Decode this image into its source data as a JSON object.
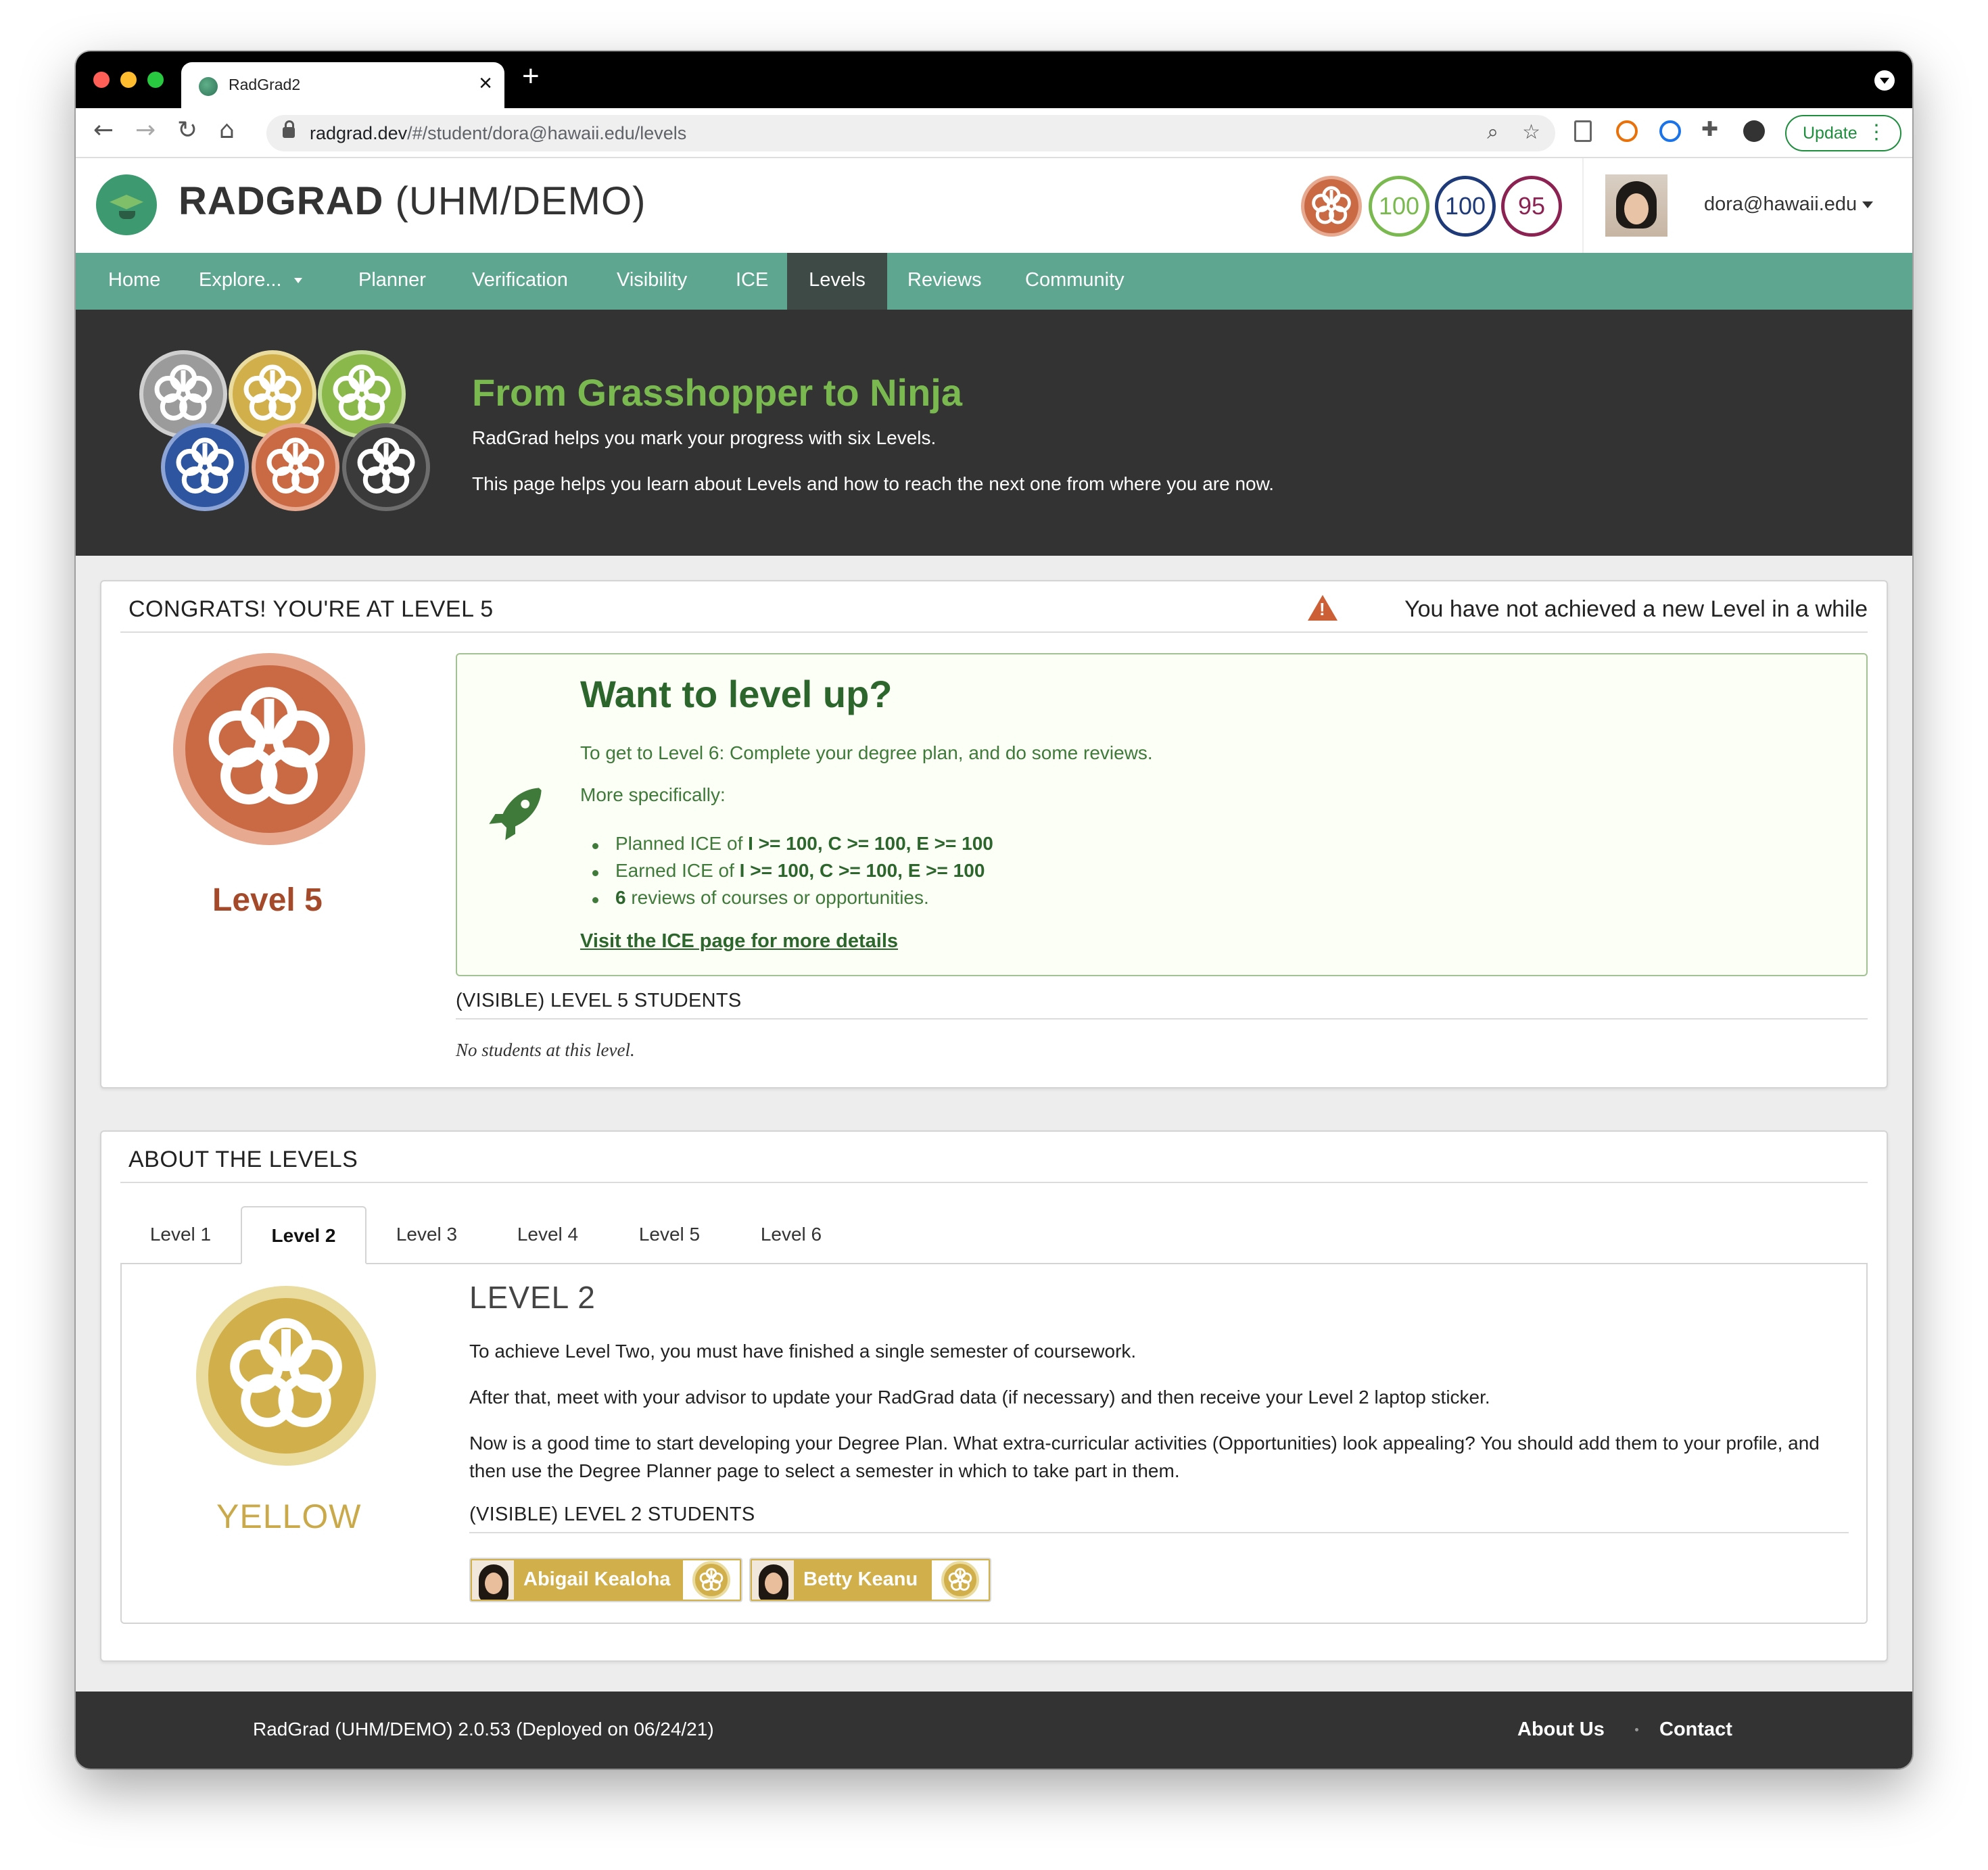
{
  "browser": {
    "tab_title": "RadGrad2",
    "url_host": "radgrad.dev",
    "url_path": "/#/student/dora@hawaii.edu/levels",
    "update_label": "Update"
  },
  "header": {
    "title_bold": "RADGRAD",
    "title_rest": " (UHM/DEMO)",
    "scores": [
      {
        "value": "100",
        "color": "#79b94f"
      },
      {
        "value": "100",
        "color": "#1e3a78"
      },
      {
        "value": "95",
        "color": "#8b2252"
      }
    ],
    "user_email": "dora@hawaii.edu"
  },
  "menu": {
    "items": [
      "Home",
      "Explore...",
      "Planner",
      "Verification",
      "Visibility",
      "ICE",
      "Levels",
      "Reviews",
      "Community"
    ],
    "active": "Levels"
  },
  "hero": {
    "title": "From Grasshopper to Ninja",
    "line1": "RadGrad helps you mark your progress with six Levels.",
    "line2": "This page helps you learn about Levels and how to reach the next one from where you are now."
  },
  "current_level": {
    "header": "CONGRATS! YOU'RE AT LEVEL 5",
    "warning": "You have not achieved a new Level in a while",
    "label": "Level 5",
    "levelup": {
      "title": "Want to level up?",
      "line1": "To get to Level 6: Complete your degree plan, and do some reviews.",
      "line2": "More specifically:",
      "items": [
        {
          "prefix": "Planned ICE of ",
          "bold": "I >= 100, C >= 100, E >= 100",
          "suffix": ""
        },
        {
          "prefix": "Earned ICE of ",
          "bold": "I >= 100, C >= 100, E >= 100",
          "suffix": ""
        },
        {
          "prefix": "",
          "bold": "6",
          "suffix": " reviews of courses or opportunities."
        }
      ],
      "link": "Visit the ICE page for more details"
    },
    "students_header": "(VISIBLE) LEVEL 5 STUDENTS",
    "no_students": "No students at this level."
  },
  "about": {
    "header": "ABOUT THE LEVELS",
    "tabs": [
      "Level 1",
      "Level 2",
      "Level 3",
      "Level 4",
      "Level 5",
      "Level 6"
    ],
    "active_tab": "Level 2",
    "panel": {
      "title": "LEVEL 2",
      "color_name": "YELLOW",
      "p1": "To achieve Level Two, you must have finished a single semester of coursework.",
      "p2": "After that, meet with your advisor to update your RadGrad data (if necessary) and then receive your Level 2 laptop sticker.",
      "p3": "Now is a good time to start developing your Degree Plan. What extra-curricular activities (Opportunities) look appealing? You should add them to your profile, and then use the Degree Planner page to select a semester in which to take part in them.",
      "students_header": "(VISIBLE) LEVEL 2 STUDENTS",
      "students": [
        "Abigail Kealoha",
        "Betty Keanu"
      ]
    }
  },
  "footer": {
    "text": "RadGrad (UHM/DEMO) 2.0.53 (Deployed on 06/24/21)",
    "about": "About Us",
    "contact": "Contact"
  },
  "level_colors": {
    "level1": "#9b9b9b",
    "level2": "#d1b04b",
    "level3": "#8bb84a",
    "level4": "#2e56a0",
    "level5": "#c96a45",
    "level6": "#3a3a3a"
  }
}
